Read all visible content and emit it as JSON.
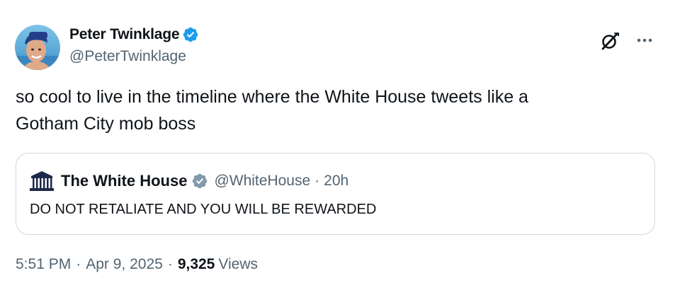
{
  "author": {
    "name": "Peter Twinklage",
    "handle": "@PeterTwinklage",
    "verified": true,
    "avatar_icon": "profile-photo"
  },
  "tweet": {
    "text_line1": "so cool to live in the timeline where the White House tweets like a",
    "text_line2": "Gotham City mob boss"
  },
  "quote": {
    "name": "The White House",
    "handle": "@WhiteHouse",
    "separator": "·",
    "time": "20h",
    "text": "DO NOT RETALIATE AND YOU WILL BE REWARDED",
    "logo_icon": "white-house-logo",
    "badge": "gray-verified"
  },
  "meta": {
    "time": "5:51 PM",
    "separator": "·",
    "date": "Apr 9, 2025",
    "views_count": "9,325",
    "views_label": "Views"
  },
  "actions": {
    "grok_icon": "grok-icon",
    "more_icon": "more-icon"
  },
  "colors": {
    "text": "#0f1419",
    "secondary": "#536471",
    "verified_blue": "#1d9bf0",
    "verified_gray": "#829aab",
    "border": "#cfd9de"
  }
}
